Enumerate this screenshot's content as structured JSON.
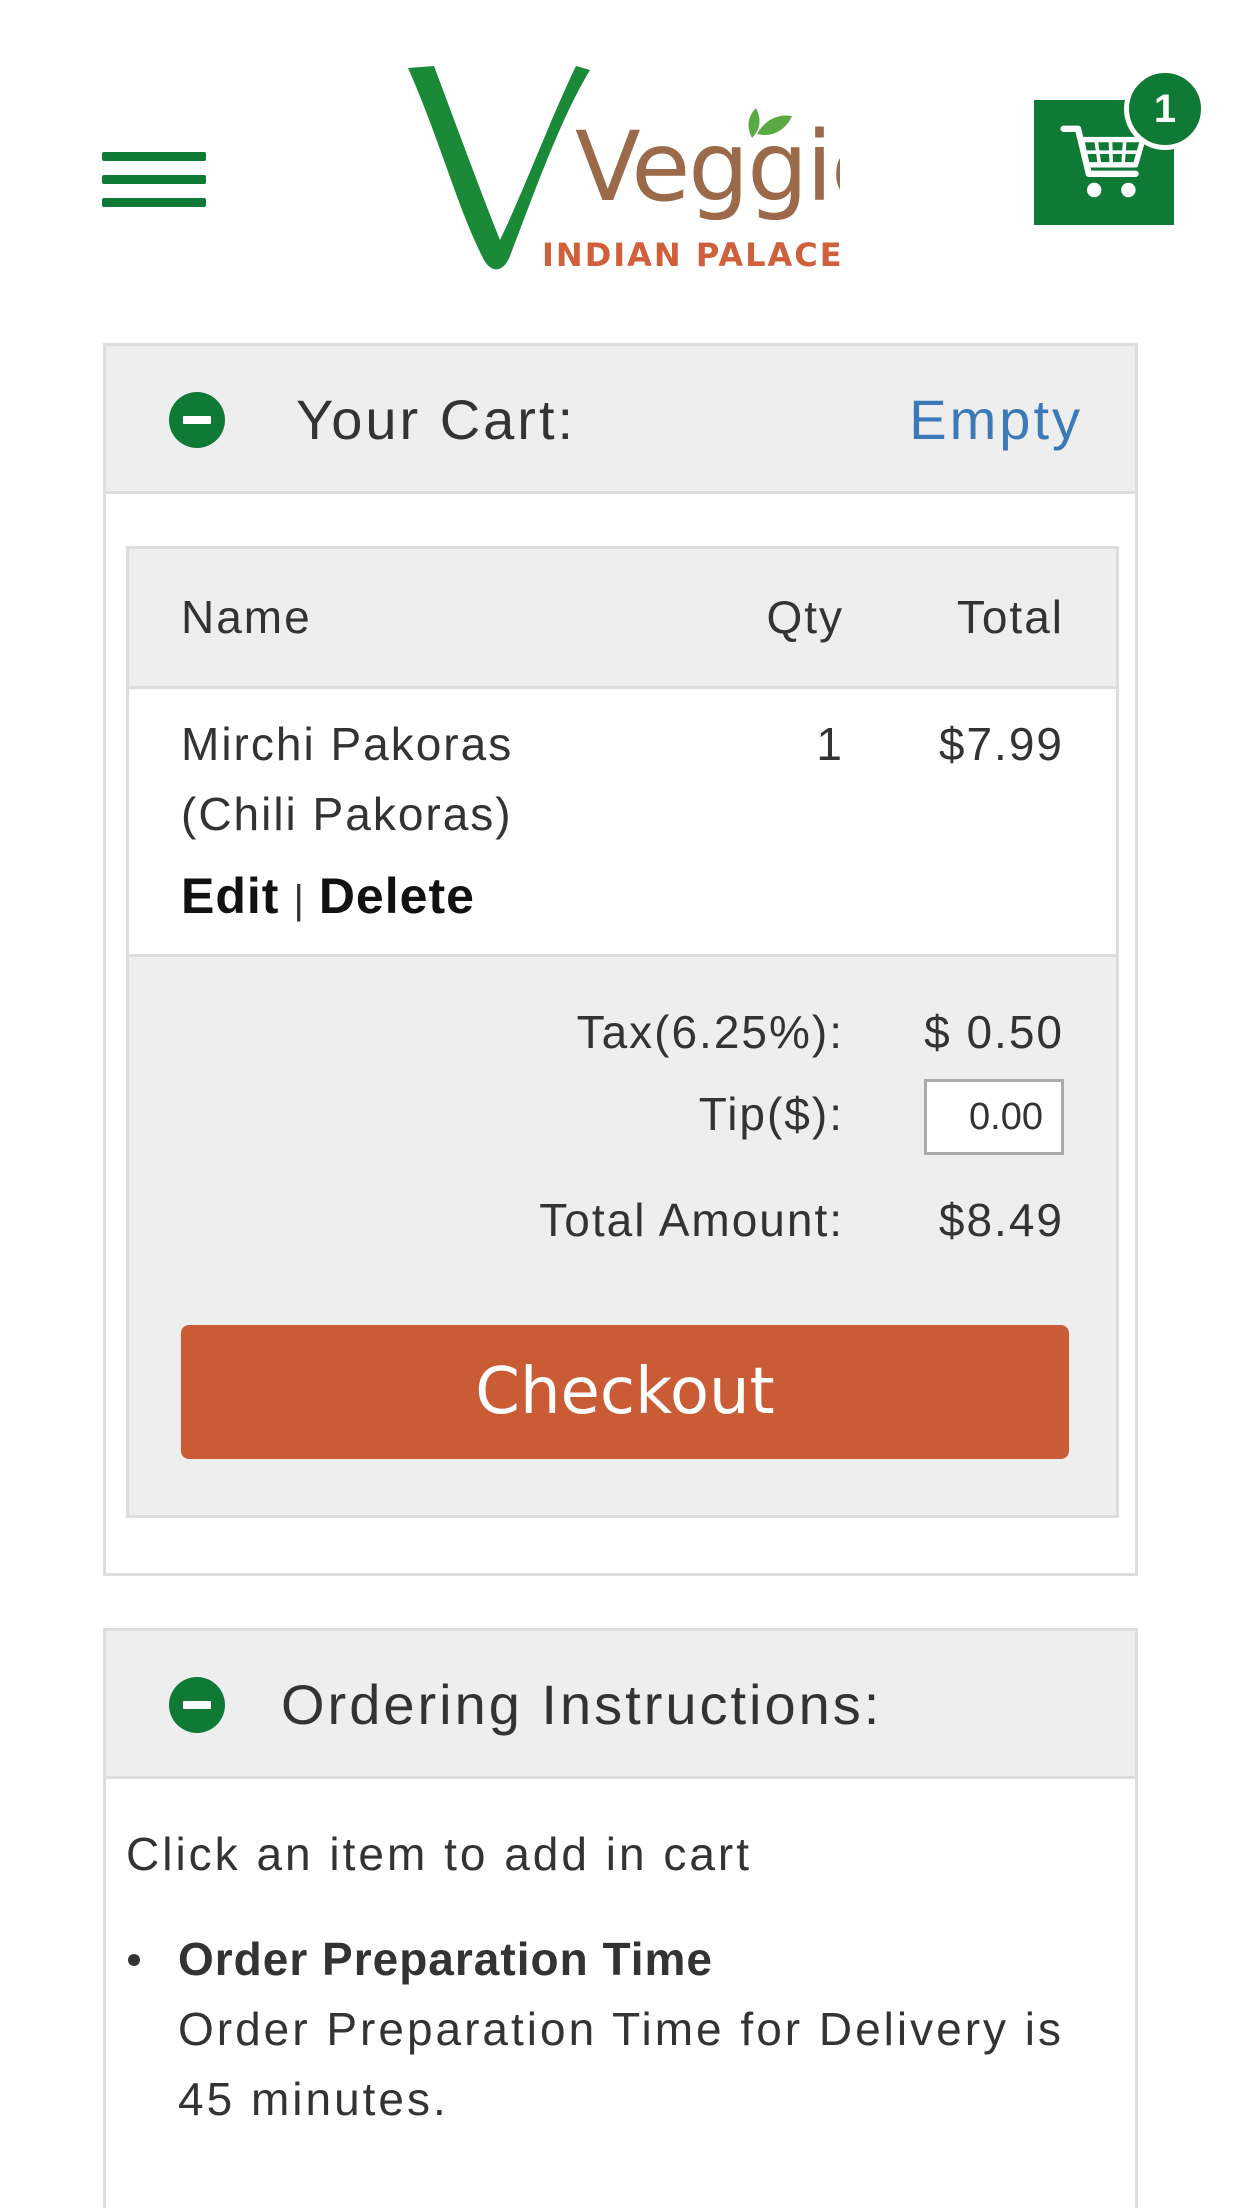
{
  "header": {
    "logo": {
      "brand": "Veggie",
      "sub": "INDIAN PALACE",
      "colors": {
        "green": "#1a8a38",
        "brown": "#9a6a4a",
        "sub": "#d0603c"
      }
    },
    "menu_icon": "hamburger-icon",
    "cart": {
      "icon": "shopping-cart-icon",
      "count": "1"
    }
  },
  "cart_panel": {
    "toggle_icon": "minus-circle-icon",
    "title": "Your Cart:",
    "status": "Empty",
    "table": {
      "headers": {
        "name": "Name",
        "qty": "Qty",
        "total": "Total"
      },
      "items": [
        {
          "name": "Mirchi Pakoras (Chili Pakoras)",
          "qty": "1",
          "total": "$7.99",
          "edit_label": "Edit",
          "separator": "|",
          "delete_label": "Delete"
        }
      ]
    },
    "summary": {
      "tax_label": "Tax(6.25%):",
      "tax_value": "$ 0.50",
      "tip_label": "Tip($):",
      "tip_value": "0.00",
      "total_label": "Total Amount:",
      "total_value": "$8.49"
    },
    "checkout_label": "Checkout"
  },
  "instructions_panel": {
    "toggle_icon": "minus-circle-icon",
    "title": "Ordering Instructions:",
    "intro": "Click an item to add in cart",
    "items": [
      {
        "heading": "Order Preparation Time",
        "text": "Order Preparation Time for Delivery is 45 minutes."
      }
    ]
  },
  "colors": {
    "brand_green": "#0f7a35",
    "checkout_orange": "#c95b35",
    "status_blue": "#3a7ab8",
    "panel_gray": "#eeeeee"
  }
}
